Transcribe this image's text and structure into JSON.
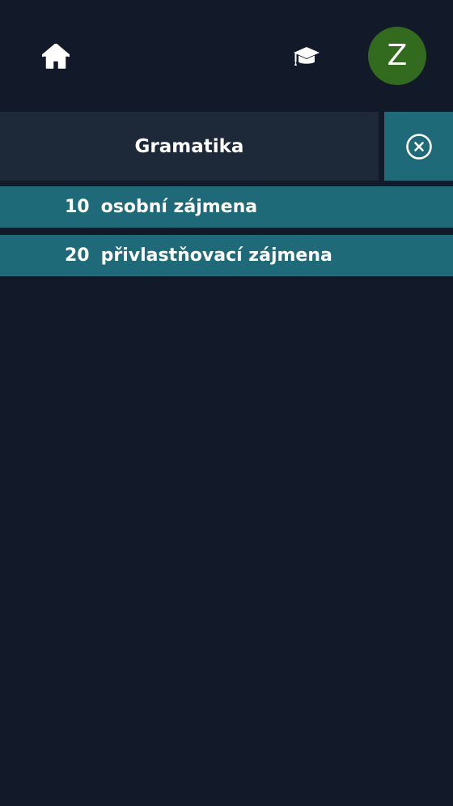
{
  "header": {
    "home_icon": "home-icon",
    "education_icon": "graduation-cap-icon",
    "avatar_initial": "Z",
    "avatar_color": "#336b1e"
  },
  "section": {
    "title": "Gramatika",
    "close_icon": "close-circle-icon"
  },
  "lessons": [
    {
      "number": "10",
      "label": "osobní zájmena"
    },
    {
      "number": "20",
      "label": "přivlastňovací zájmena"
    }
  ],
  "colors": {
    "background": "#121928",
    "header_panel": "#1d2939",
    "accent": "#1f6a78"
  }
}
